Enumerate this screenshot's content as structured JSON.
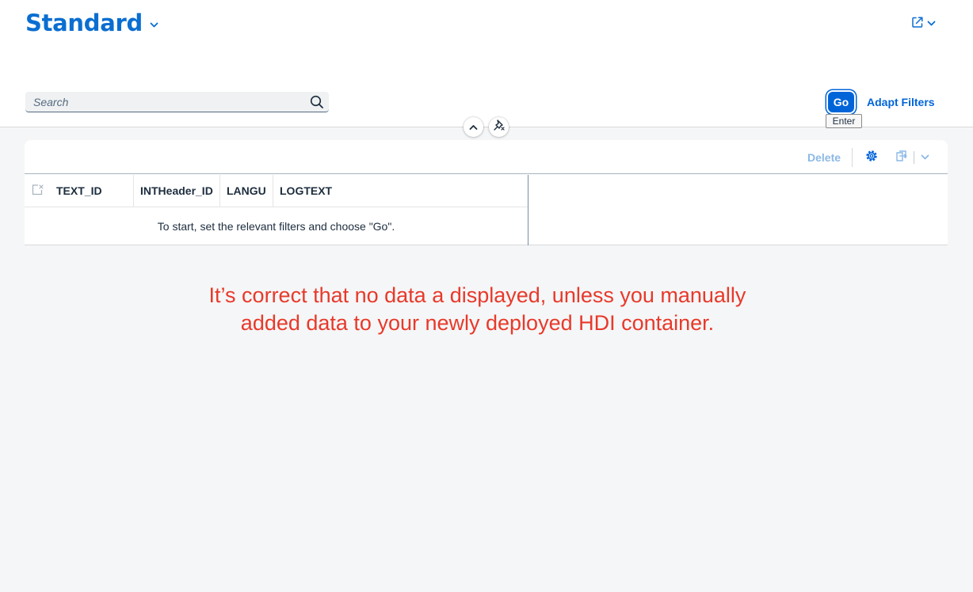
{
  "header": {
    "variant_title": "Standard",
    "search_placeholder": "Search",
    "go_label": "Go",
    "go_tooltip": "Enter",
    "adapt_filters_label": "Adapt Filters"
  },
  "table": {
    "toolbar": {
      "delete_label": "Delete"
    },
    "columns": [
      "TEXT_ID",
      "INTHeader_ID",
      "LANGU",
      "LOGTEXT"
    ],
    "no_data_text": "To start, set the relevant filters and choose \"Go\"."
  },
  "annotation": {
    "text": "It’s correct that no data a displayed, unless you manually\nadded data to your newly deployed HDI container."
  },
  "colors": {
    "brand": "#0a6ed1",
    "accent": "#0064d9",
    "annotation": "#e8392a"
  },
  "icons": [
    "chevron-down-icon",
    "share-icon",
    "search-icon",
    "chevron-up-icon",
    "unpin-icon",
    "gear-icon",
    "export-icon",
    "select-all-icon"
  ]
}
